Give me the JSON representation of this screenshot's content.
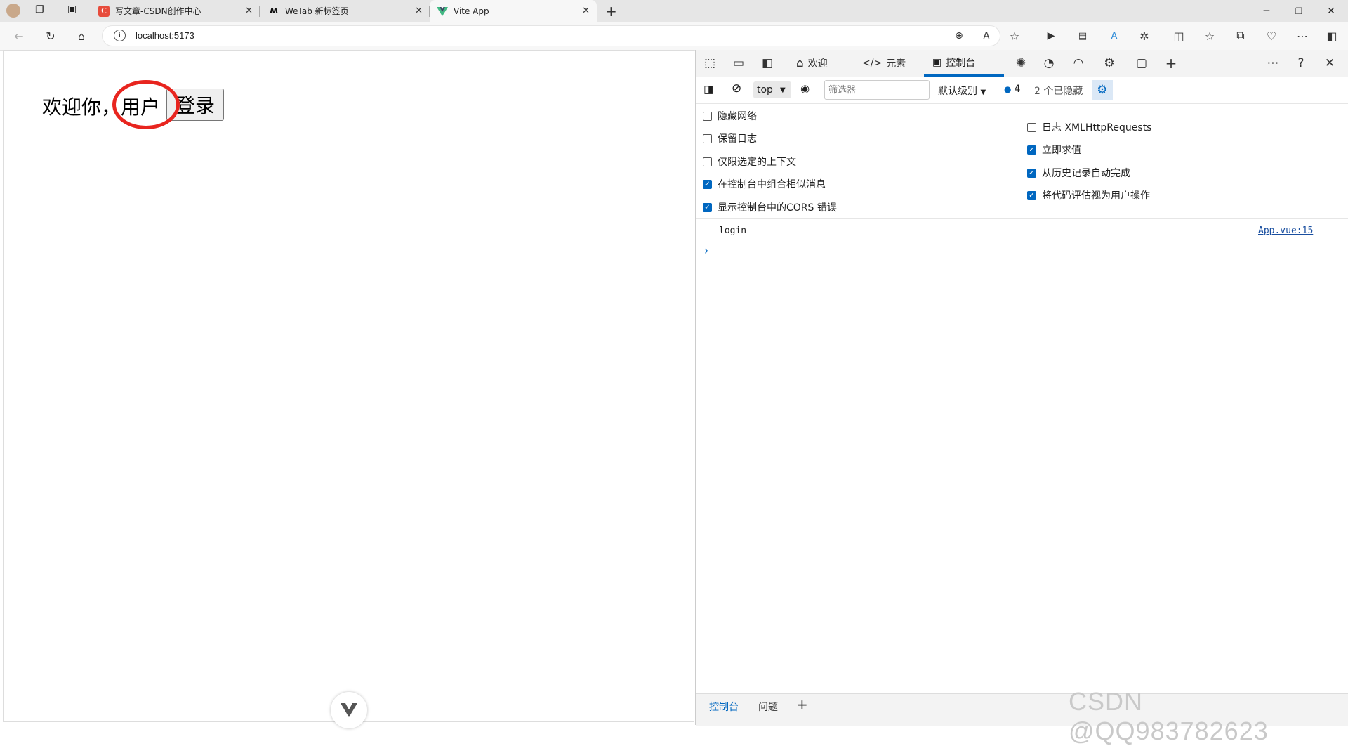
{
  "tabs": [
    {
      "title": "写文章-CSDN创作中心",
      "favicon_color": "#e74c3c",
      "favicon": "C"
    },
    {
      "title": "WeTab 新标签页",
      "favicon_color": "#111111",
      "favicon": "W"
    },
    {
      "title": "Vite App",
      "favicon_color": "#41b883",
      "favicon": "V"
    }
  ],
  "address": {
    "url": "localhost:5173"
  },
  "page": {
    "greeting": "欢迎你，用户",
    "login_button": "登录"
  },
  "devtools": {
    "tabs": {
      "welcome": "欢迎",
      "elements": "元素",
      "console": "控制台"
    },
    "context": "top",
    "filter_placeholder": "筛选器",
    "level": "默认级别",
    "message_count": "4",
    "hidden_count": "2 个已隐藏",
    "settings_left": [
      {
        "label": "隐藏网络",
        "checked": false
      },
      {
        "label": "保留日志",
        "checked": false
      },
      {
        "label": "仅限选定的上下文",
        "checked": false
      },
      {
        "label": "在控制台中组合相似消息",
        "checked": true
      },
      {
        "label": "显示控制台中的CORS 错误",
        "checked": true
      }
    ],
    "settings_right": [
      {
        "label": "日志 XMLHttpRequests",
        "checked": false
      },
      {
        "label": "立即求值",
        "checked": true
      },
      {
        "label": "从历史记录自动完成",
        "checked": true
      },
      {
        "label": "将代码评估视为用户操作",
        "checked": true
      }
    ],
    "console_lines": [
      {
        "text": "login",
        "source": "App.vue:15"
      }
    ],
    "drawer_tabs": {
      "console": "控制台",
      "issues": "问题"
    }
  },
  "watermark": "CSDN @QQ983782623",
  "colors": {
    "accent": "#0067c0",
    "annotation": "#e8251f"
  }
}
